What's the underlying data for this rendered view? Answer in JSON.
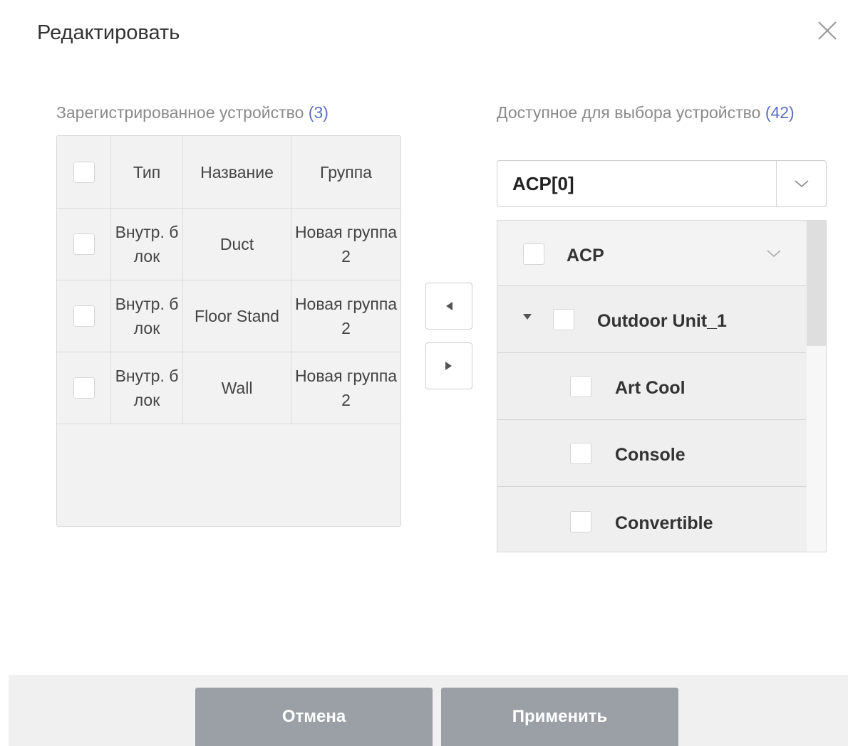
{
  "dialog": {
    "title": "Редактировать"
  },
  "registered": {
    "label": "Зарегистрированное устройство",
    "count": "(3)",
    "columns": [
      "Тип",
      "Название",
      "Группа"
    ],
    "rows": [
      {
        "type": "Внутр. блок",
        "name": "Duct",
        "group": "Новая группа 2"
      },
      {
        "type": "Внутр. блок",
        "name": "Floor Stand",
        "group": "Новая группа 2"
      },
      {
        "type": "Внутр. блок",
        "name": "Wall",
        "group": "Новая группа 2"
      }
    ]
  },
  "available": {
    "label": "Доступное для выбора устройство",
    "count": "(42)",
    "dropdown_value": "ACP[0]",
    "tree": {
      "root": "ACP",
      "unit": "Outdoor Unit_1",
      "children": [
        "Art Cool",
        "Console",
        "Convertible"
      ]
    }
  },
  "footer": {
    "cancel_label": "Отмена",
    "apply_label": "Применить"
  },
  "colors": {
    "count_accent": "#5b6fc2",
    "footer_button": "#9aa0a6"
  }
}
